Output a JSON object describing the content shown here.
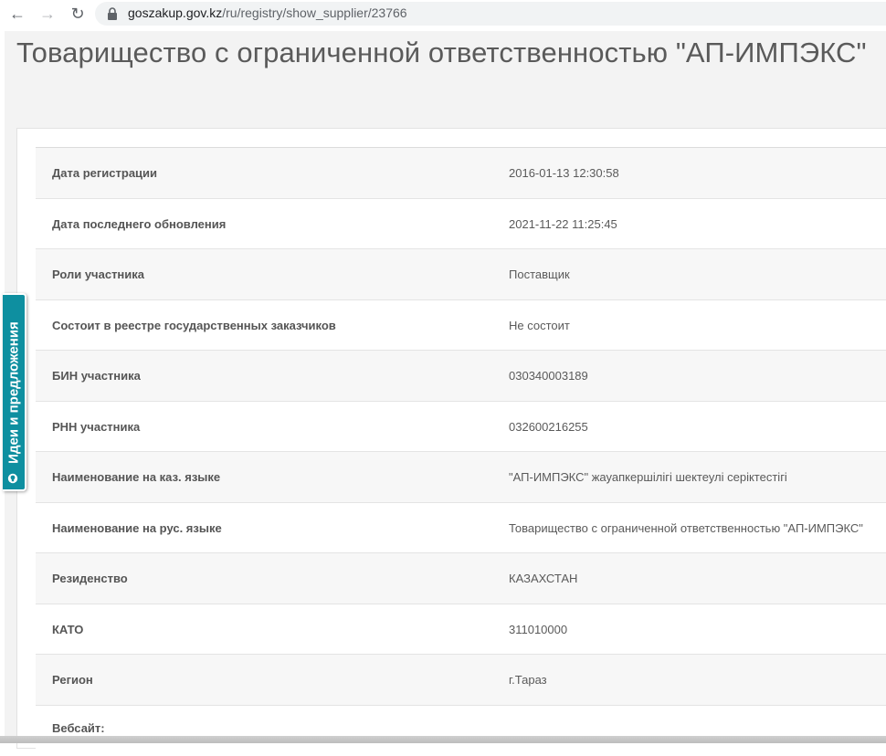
{
  "browser": {
    "url_host": "goszakup.gov.kz",
    "url_path": "/ru/registry/show_supplier/23766"
  },
  "page": {
    "title": "Товарищество с ограниченной ответственностью \"АП-ИМПЭКС\""
  },
  "details": [
    {
      "label": "Дата регистрации",
      "value": "2016-01-13 12:30:58"
    },
    {
      "label": "Дата последнего обновления",
      "value": "2021-11-22 11:25:45"
    },
    {
      "label": "Роли участника",
      "value": "Поставщик"
    },
    {
      "label": "Состоит в реестре государственных заказчиков",
      "value": "Не состоит"
    },
    {
      "label": "БИН участника",
      "value": "030340003189"
    },
    {
      "label": "РНН участника",
      "value": "032600216255"
    },
    {
      "label": "Наименование на каз. языке",
      "value": "\"АП-ИМПЭКС\" жауапкершілігі шектеулі серіктестігі"
    },
    {
      "label": "Наименование на рус. языке",
      "value": "Товарищество с ограниченной ответственностью \"АП-ИМПЭКС\""
    },
    {
      "label": "Резиденство",
      "value": "КАЗАХСТАН"
    },
    {
      "label": "КАТО",
      "value": "311010000"
    },
    {
      "label": "Регион",
      "value": "г.Тараз"
    },
    {
      "label": "Вебсайт:",
      "value": ""
    }
  ],
  "feedback": {
    "label": "Идеи и предложения",
    "color": "#0e8fa0"
  },
  "icons": {
    "back": "arrow-left-icon",
    "forward": "arrow-right-icon",
    "reload": "reload-icon",
    "lock": "lock-icon",
    "bulb": "lightbulb-icon"
  }
}
